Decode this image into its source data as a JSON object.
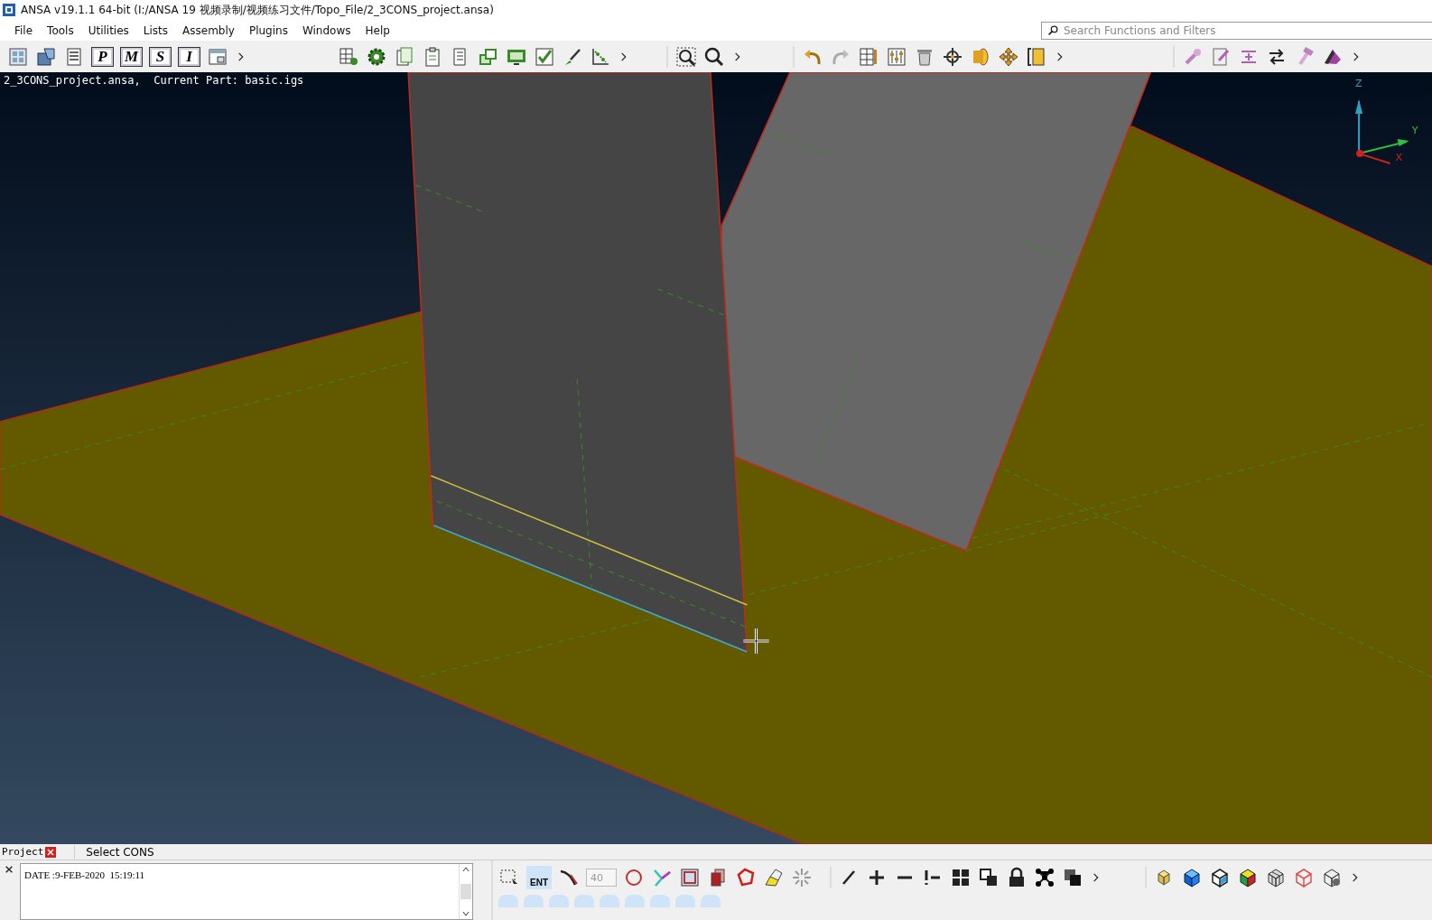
{
  "window": {
    "title": "ANSA v19.1.1 64-bit (I:/ANSA 19 视频录制/视频练习文件/Topo_File/2_3CONS_project.ansa)"
  },
  "menu": [
    "File",
    "Tools",
    "Utilities",
    "Lists",
    "Assembly",
    "Plugins",
    "Windows",
    "Help"
  ],
  "search": {
    "placeholder": "Search Functions and Filters"
  },
  "toolbar": {
    "letter_buttons": [
      "P",
      "M",
      "S",
      "I"
    ]
  },
  "viewport": {
    "info": "2_3CONS_project.ansa,  Current Part: basic.igs",
    "axes": [
      "Z",
      "Y",
      "X"
    ]
  },
  "bottom": {
    "tab": "Project",
    "prompt": "Select CONS",
    "log": [
      "DATE :9-FEB-2020  15:19:11"
    ],
    "spin_value": "40",
    "ent_label": "ENT"
  }
}
